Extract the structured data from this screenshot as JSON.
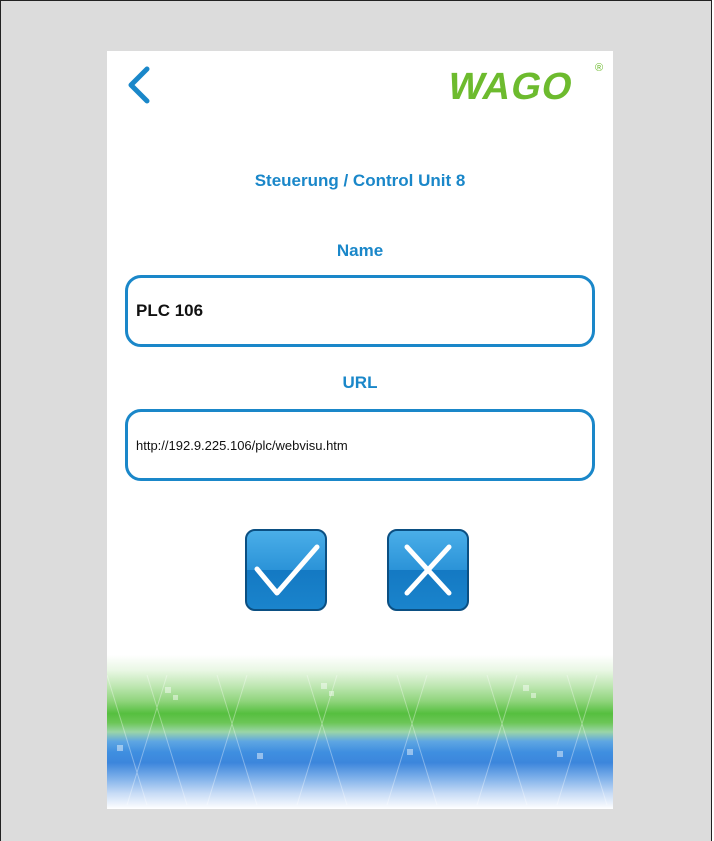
{
  "header": {
    "back_icon": "chevron-left-icon",
    "logo_text": "WAGO",
    "logo_registered": "®"
  },
  "title": "Steuerung / Control Unit 8",
  "name_field": {
    "label": "Name",
    "value": "PLC 106"
  },
  "url_field": {
    "label": "URL",
    "value": "http://192.9.225.106/plc/webvisu.htm"
  },
  "actions": {
    "confirm_icon": "checkmark-icon",
    "cancel_icon": "close-icon"
  },
  "colors": {
    "accent": "#1a87c9",
    "logo_green": "#6dbb2e",
    "backdrop": "#dcdcdc"
  }
}
